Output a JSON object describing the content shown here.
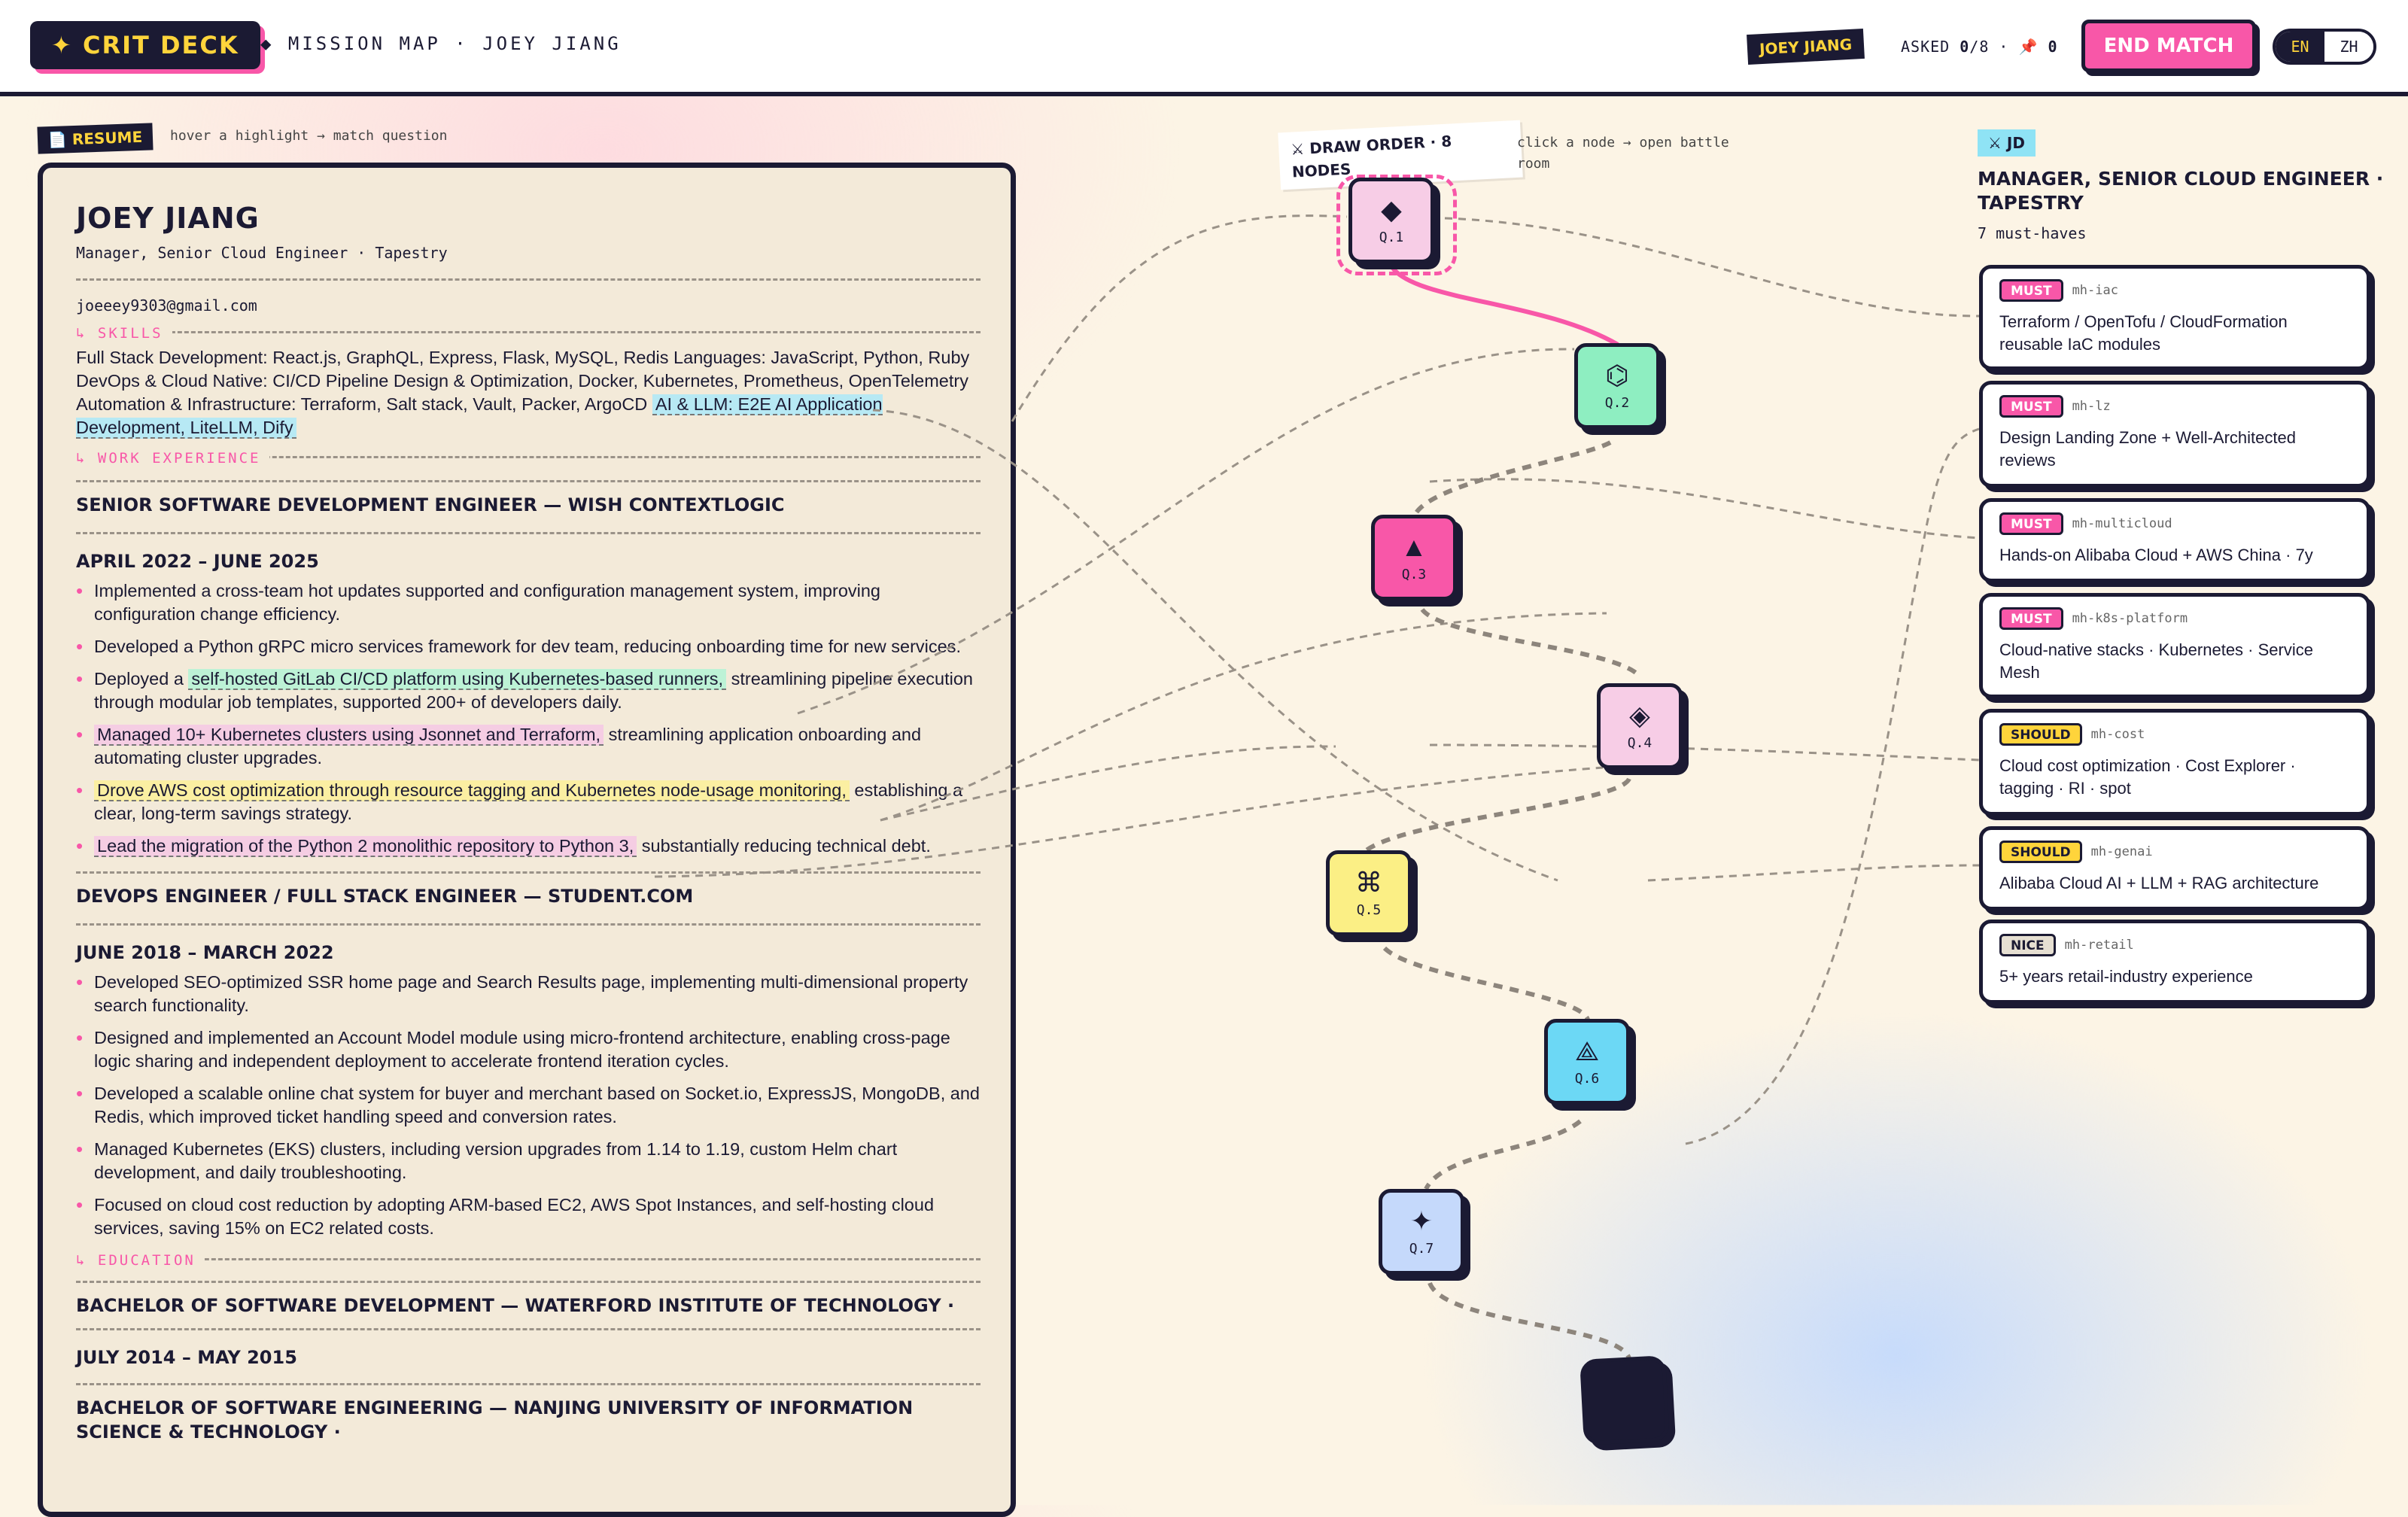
{
  "topbar": {
    "logo": "✦ CRIT DECK",
    "breadcrumb": "◆ MISSION MAP · JOEY JIANG",
    "candidate_tag": "JOEY JIANG",
    "asked_label": "ASKED ",
    "asked_count": "0",
    "asked_total": "/8 · ",
    "pin_icon": "📌",
    "pin_count": " 0",
    "end_match": "END MATCH",
    "lang": {
      "en": "EN",
      "zh": "ZH",
      "active": "EN"
    }
  },
  "resume": {
    "tag": "📄 RESUME",
    "hint": "hover a highlight → match question",
    "name": "JOEY JIANG",
    "subtitle": "Manager, Senior Cloud Engineer · Tapestry",
    "email": "joeeey9303@gmail.com",
    "skills_heading": "↳ SKILLS",
    "skills_text": "Full Stack Development: React.js, GraphQL, Express, Flask, MySQL, Redis Languages: JavaScript, Python, Ruby DevOps & Cloud Native: CI/CD Pipeline Design & Optimization, Docker, Kubernetes, Prometheus, OpenTelemetry Automation & Infrastructure: Terraform, Salt stack, Vault, Packer, ArgoCD",
    "skills_highlight": "AI & LLM: E2E AI Application Development, LiteLLM, Dify",
    "work_heading": "↳ WORK EXPERIENCE",
    "job1": {
      "title": "SENIOR SOFTWARE DEVELOPMENT ENGINEER — WISH CONTEXTLOGIC",
      "period": "APRIL 2022 – JUNE 2025",
      "b1": "Implemented a cross-team hot updates supported and configuration management system, improving configuration change efficiency.",
      "b2": "Developed a Python gRPC micro services framework for dev team, reducing onboarding time for new services.",
      "b3_pre": "Deployed a ",
      "b3_hl": "self-hosted GitLab CI/CD platform using Kubernetes-based runners,",
      "b3_post": " streamlining pipeline execution through modular job templates, supported 200+ of developers daily.",
      "b4_hl": "Managed 10+ Kubernetes clusters using Jsonnet and Terraform,",
      "b4_post": " streamlining application onboarding and automating cluster upgrades.",
      "b5_hl": "Drove AWS cost optimization through resource tagging and Kubernetes node-usage monitoring,",
      "b5_post": " establishing a clear, long-term savings strategy.",
      "b6_hl": "Lead the migration of the Python 2 monolithic repository to Python 3,",
      "b6_post": " substantially reducing technical debt."
    },
    "job2": {
      "title": "DEVOPS ENGINEER / FULL STACK ENGINEER — STUDENT.COM",
      "period": "JUNE 2018 – MARCH 2022",
      "b1": "Developed SEO-optimized SSR home page and Search Results page, implementing multi-dimensional property search functionality.",
      "b2": "Designed and implemented an Account Model module using micro-frontend architecture, enabling cross-page logic sharing and independent deployment to accelerate frontend iteration cycles.",
      "b3": "Developed a scalable online chat system for buyer and merchant based on Socket.io, ExpressJS, MongoDB, and Redis, which improved ticket handling speed and conversion rates.",
      "b4": "Managed Kubernetes (EKS) clusters, including version upgrades from 1.14 to 1.19, custom Helm chart development, and daily troubleshooting.",
      "b5": "Focused on cloud cost reduction by adopting ARM-based EC2, AWS Spot Instances, and self-hosting cloud services, saving 15% on EC2 related costs."
    },
    "edu_heading": "↳ EDUCATION",
    "edu1": "BACHELOR OF SOFTWARE DEVELOPMENT — WATERFORD INSTITUTE OF TECHNOLOGY ·",
    "edu1_period": "JULY 2014 – MAY 2015",
    "edu2": "BACHELOR OF SOFTWARE ENGINEERING — NANJING UNIVERSITY OF INFORMATION SCIENCE & TECHNOLOGY ·"
  },
  "map": {
    "tag": "⚔ DRAW ORDER · 8 NODES",
    "hint": "click a node → open battle room",
    "nodes": [
      {
        "label": "Q.1",
        "glyph": "◆",
        "color": "#f7cde6"
      },
      {
        "label": "Q.2",
        "glyph": "⌬",
        "color": "#8eeec1"
      },
      {
        "label": "Q.3",
        "glyph": "▲",
        "color": "#f857a8"
      },
      {
        "label": "Q.4",
        "glyph": "◈",
        "color": "#f7cde6"
      },
      {
        "label": "Q.5",
        "glyph": "⌘",
        "color": "#fbef85"
      },
      {
        "label": "Q.6",
        "glyph": "⟁",
        "color": "#6cd8f5"
      },
      {
        "label": "Q.7",
        "glyph": "✦",
        "color": "#c5d9fb"
      },
      {
        "label": "",
        "glyph": "",
        "color": "#1b1a33"
      }
    ]
  },
  "jd": {
    "tag": "⚔ JD",
    "title": "MANAGER, SENIOR CLOUD ENGINEER · TAPESTRY",
    "count": "7 must-haves",
    "items": [
      {
        "level": "MUST",
        "id": "mh-iac",
        "text": "Terraform / OpenTofu / CloudFormation reusable IaC modules"
      },
      {
        "level": "MUST",
        "id": "mh-lz",
        "text": "Design Landing Zone + Well-Architected reviews"
      },
      {
        "level": "MUST",
        "id": "mh-multicloud",
        "text": "Hands-on Alibaba Cloud + AWS China · 7y"
      },
      {
        "level": "MUST",
        "id": "mh-k8s-platform",
        "text": "Cloud-native stacks · Kubernetes · Service Mesh"
      },
      {
        "level": "SHOULD",
        "id": "mh-cost",
        "text": "Cloud cost optimization · Cost Explorer · tagging · RI · spot"
      },
      {
        "level": "SHOULD",
        "id": "mh-genai",
        "text": "Alibaba Cloud AI + LLM + RAG architecture"
      },
      {
        "level": "NICE",
        "id": "mh-retail",
        "text": "5+ years retail-industry experience"
      }
    ]
  },
  "colors": {
    "ink": "#1b1a33",
    "pink": "#f857a8",
    "yellow": "#ffd43b",
    "cyan": "#8fe3f5"
  }
}
